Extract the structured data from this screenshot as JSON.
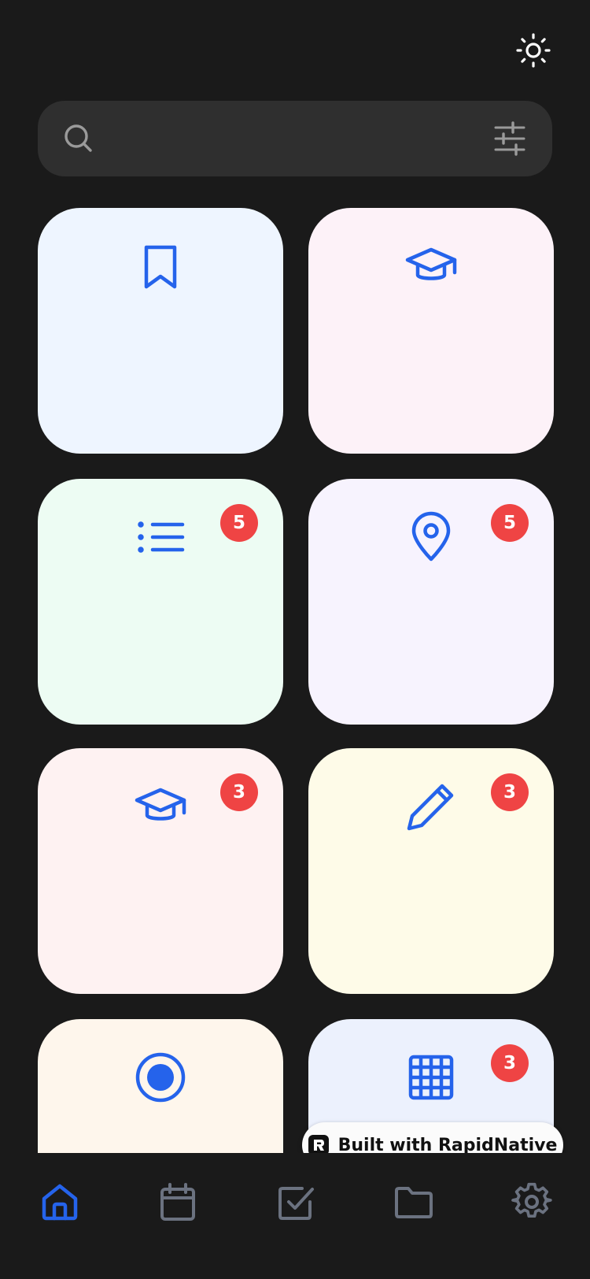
{
  "header": {
    "theme_toggle_icon": "sun-icon"
  },
  "search": {
    "search_icon": "search-icon",
    "filter_icon": "sliders-icon"
  },
  "colors": {
    "background": "#1a1a1a",
    "search_bg": "#2f2f2f",
    "accent_blue": "#2563eb",
    "badge_red": "#ef4444",
    "nav_inactive": "#6b7280"
  },
  "cards": [
    {
      "icon": "bookmark-icon",
      "bg": "#eef5ff",
      "badge": null
    },
    {
      "icon": "graduation-cap-icon",
      "bg": "#fdf2f8",
      "badge": null
    },
    {
      "icon": "list-icon",
      "bg": "#edfcf3",
      "badge": "5"
    },
    {
      "icon": "map-pin-icon",
      "bg": "#f7f3fe",
      "badge": "5"
    },
    {
      "icon": "graduation-cap-icon",
      "bg": "#fef2f2",
      "badge": "3"
    },
    {
      "icon": "pencil-icon",
      "bg": "#fefbe8",
      "badge": "3"
    },
    {
      "icon": "record-icon",
      "bg": "#fef6ec",
      "badge": null
    },
    {
      "icon": "grid-icon",
      "bg": "#ecf1fd",
      "badge": "3"
    }
  ],
  "watermark": {
    "label": "Built with RapidNative"
  },
  "bottom_nav": {
    "items": [
      {
        "icon": "home-icon",
        "active": true
      },
      {
        "icon": "calendar-icon",
        "active": false
      },
      {
        "icon": "checkbox-icon",
        "active": false
      },
      {
        "icon": "folder-icon",
        "active": false
      },
      {
        "icon": "settings-icon",
        "active": false
      }
    ]
  }
}
